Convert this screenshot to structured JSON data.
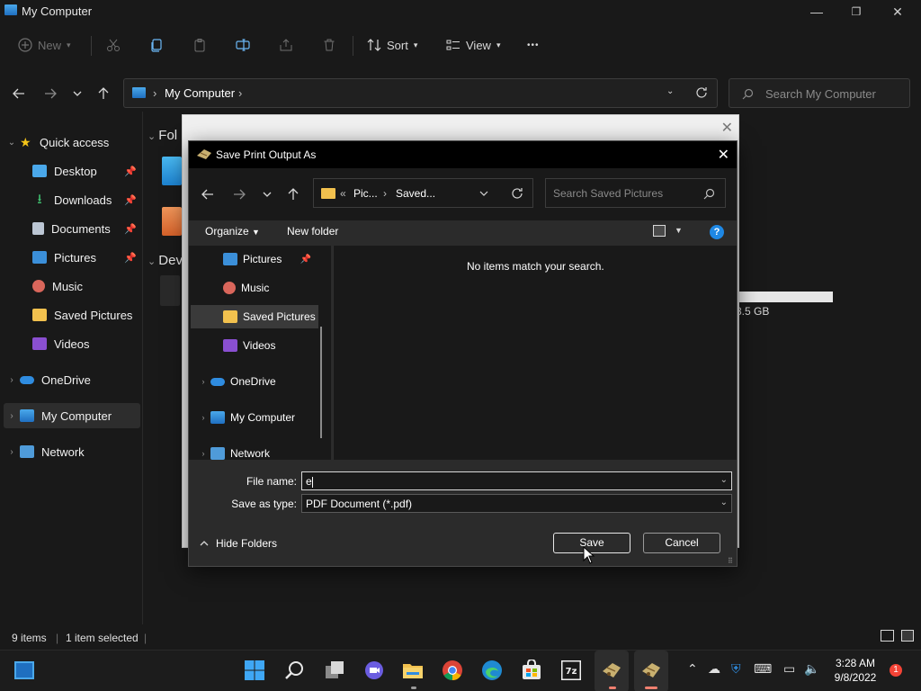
{
  "window": {
    "title": "My Computer",
    "min_glyph": "—",
    "max_glyph": "❐",
    "close_glyph": "✕"
  },
  "commandbar": {
    "new_label": "New",
    "sort_label": "Sort",
    "view_label": "View",
    "more_label": "•••"
  },
  "address": {
    "crumb": "My Computer",
    "search_placeholder": "Search My Computer"
  },
  "nav_pane": {
    "quick_access": "Quick access",
    "items": [
      {
        "label": "Desktop",
        "pinned": true
      },
      {
        "label": "Downloads",
        "pinned": true
      },
      {
        "label": "Documents",
        "pinned": true
      },
      {
        "label": "Pictures",
        "pinned": true
      },
      {
        "label": "Music",
        "pinned": false
      },
      {
        "label": "Saved Pictures",
        "pinned": false
      },
      {
        "label": "Videos",
        "pinned": false
      }
    ],
    "onedrive": "OneDrive",
    "my_computer": "My Computer",
    "network": "Network"
  },
  "content": {
    "folders_header": "Fol",
    "devices_header": "Dev",
    "drive_label_fragment": ")",
    "drive_size_fragment": "8.5 GB"
  },
  "status": {
    "items": "9 items",
    "selected": "1 item selected"
  },
  "dialog_back": {
    "close_glyph": "✕"
  },
  "save_dialog": {
    "title": "Save Print Output As",
    "close_glyph": "✕",
    "path_prefix": "«",
    "path_part1": "Pic...",
    "path_part2": "Saved...",
    "search_placeholder": "Search Saved Pictures",
    "organize_label": "Organize",
    "new_folder_label": "New folder",
    "help_label": "?",
    "tree": [
      {
        "label": "Pictures",
        "pinned": true
      },
      {
        "label": "Music"
      },
      {
        "label": "Saved Pictures",
        "selected": true
      },
      {
        "label": "Videos"
      },
      {
        "label": "OneDrive"
      },
      {
        "label": "My Computer"
      },
      {
        "label": "Network"
      }
    ],
    "empty_message": "No items match your search.",
    "file_name_label": "File name:",
    "file_name_value": "e",
    "save_type_label": "Save as type:",
    "save_type_value": "PDF Document (*.pdf)",
    "hide_folders_label": "Hide Folders",
    "save_button": "Save",
    "cancel_button": "Cancel"
  },
  "taskbar": {
    "time": "3:28 AM",
    "date": "9/8/2022",
    "notification_count": "1"
  },
  "colors": {
    "background": "#191919",
    "dialog": "#2b2b2b",
    "accent_blue": "#1e88e5",
    "folder_yellow": "#f2c14e"
  }
}
